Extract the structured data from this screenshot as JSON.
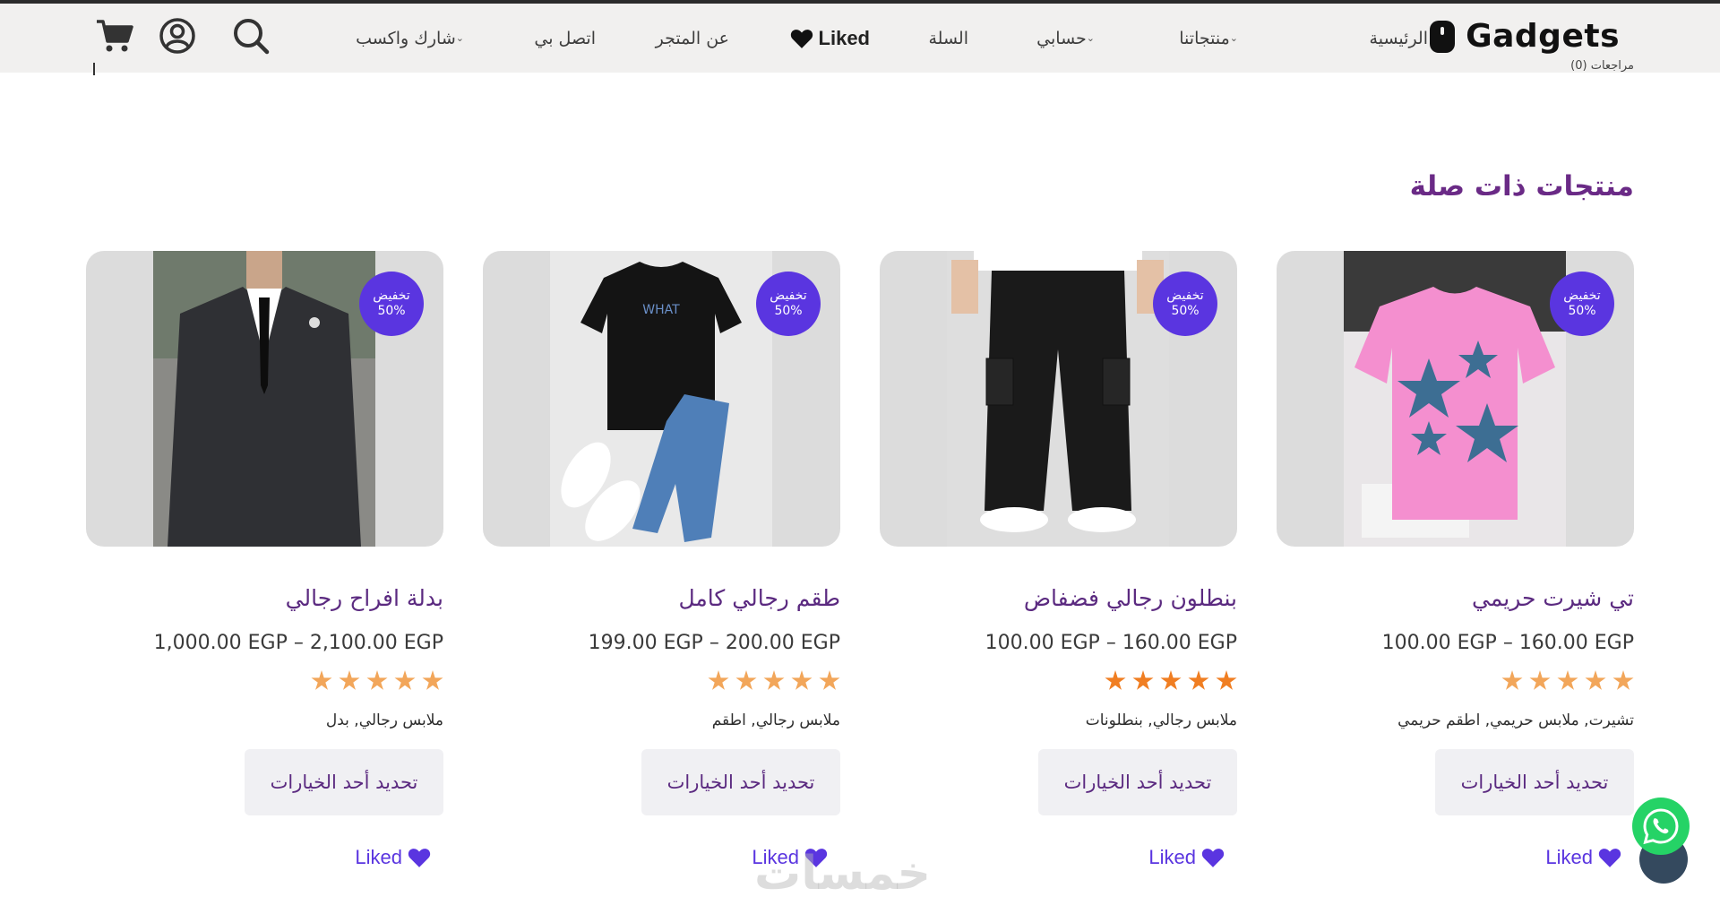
{
  "brand": {
    "name": "Gadgets"
  },
  "nav": {
    "home": "الرئيسية",
    "products": "منتجاتنا",
    "account": "حسابي",
    "cart": "السلة",
    "liked": "Liked",
    "about": "عن المتجر",
    "contact": "اتصل بي",
    "share_earn": "شارك واكسب"
  },
  "header_icons": [
    "search-icon",
    "user-icon",
    "cart-icon"
  ],
  "reviews_stub": "مراجعات (0)",
  "section": {
    "title": "منتجات ذات صلة"
  },
  "colors": {
    "badge": "#5a35e0",
    "title": "#5b2a80",
    "star_light": "#f2a65a",
    "star_dark": "#f07e22",
    "liked": "#5a35e0"
  },
  "products": [
    {
      "badge_line1": "تخفيض",
      "badge_line2": "50%",
      "title": "تي شيرت حريمي",
      "price": "100.00 EGP – 160.00 EGP",
      "rating": 5,
      "categories": "تشيرت, ملابس حريمي, اطقم حريمي",
      "button": "تحديد أحد الخيارات",
      "liked": "Liked"
    },
    {
      "badge_line1": "تخفيض",
      "badge_line2": "50%",
      "title": "بنطلون رجالي فضفاض",
      "price": "100.00 EGP – 160.00 EGP",
      "rating": 5,
      "categories": "ملابس رجالي, بنطلونات",
      "button": "تحديد أحد الخيارات",
      "liked": "Liked"
    },
    {
      "badge_line1": "تخفيض",
      "badge_line2": "50%",
      "title": "طقم رجالي كامل",
      "price": "199.00 EGP – 200.00 EGP",
      "rating": 5,
      "categories": "ملابس رجالي, اطقم",
      "button": "تحديد أحد الخيارات",
      "liked": "Liked"
    },
    {
      "badge_line1": "تخفيض",
      "badge_line2": "50%",
      "title": "بدلة افراح رجالي",
      "price": "1,000.00 EGP – 2,100.00 EGP",
      "rating": 5,
      "categories": "ملابس رجالي, بدل",
      "button": "تحديد أحد الخيارات",
      "liked": "Liked"
    }
  ],
  "watermark": "خمسات"
}
